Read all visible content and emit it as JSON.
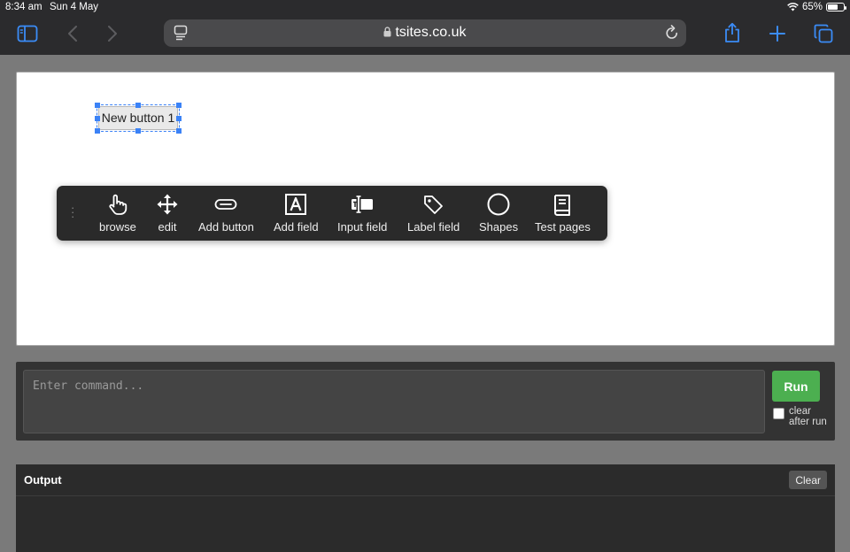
{
  "status_bar": {
    "time": "8:34 am",
    "date": "Sun 4 May",
    "battery": "65%",
    "battery_level": 0.65
  },
  "browser": {
    "url": "tsites.co.uk",
    "icons": [
      "sidebar-icon",
      "back-icon",
      "forward-icon",
      "tab-settings-icon",
      "lock-icon",
      "reload-icon",
      "share-icon",
      "new-tab-icon",
      "tabs-icon"
    ]
  },
  "canvas": {
    "selected_button_label": "New button 1"
  },
  "toolbar": {
    "tools": [
      {
        "label": "browse",
        "icon": "hand-pointer-icon"
      },
      {
        "label": "edit",
        "icon": "move-arrows-icon"
      },
      {
        "label": "Add button",
        "icon": "button-shape-icon"
      },
      {
        "label": "Add field",
        "icon": "text-box-a-icon"
      },
      {
        "label": "Input field",
        "icon": "text-input-icon"
      },
      {
        "label": "Label field",
        "icon": "tag-icon"
      },
      {
        "label": "Shapes",
        "icon": "circle-icon"
      },
      {
        "label": "Test pages",
        "icon": "book-icon"
      }
    ]
  },
  "command": {
    "placeholder": "Enter command...",
    "run_label": "Run",
    "clear_after_run_label": "clear after run",
    "clear_after_run_checked": false
  },
  "output": {
    "title": "Output",
    "clear_label": "Clear"
  },
  "colors": {
    "accent": "#3b82f6",
    "run": "#4caf50"
  }
}
